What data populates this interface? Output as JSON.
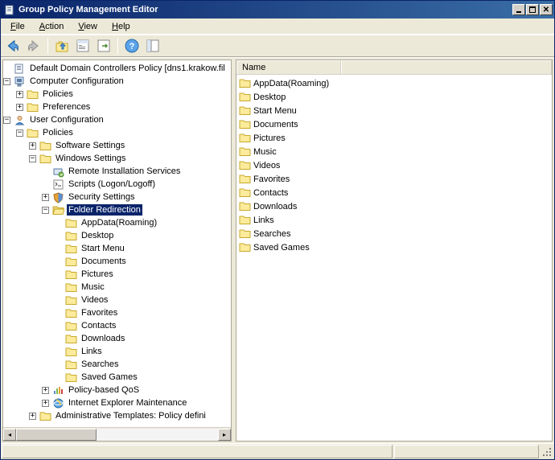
{
  "window": {
    "title": "Group Policy Management Editor"
  },
  "menu": {
    "file": "File",
    "action": "Action",
    "view": "View",
    "help": "Help"
  },
  "root": {
    "label": "Default Domain Controllers Policy [dns1.krakow.fil"
  },
  "computerCfg": {
    "label": "Computer Configuration",
    "policies": "Policies",
    "preferences": "Preferences"
  },
  "userCfg": {
    "label": "User Configuration",
    "policies": "Policies",
    "software": "Software Settings",
    "windows": "Windows Settings",
    "ris": "Remote Installation Services",
    "scripts": "Scripts (Logon/Logoff)",
    "security": "Security Settings",
    "folderRedir": "Folder Redirection",
    "qos": "Policy-based QoS",
    "ie": "Internet Explorer Maintenance",
    "adminTpl": "Administrative Templates: Policy defini"
  },
  "redir": {
    "items": [
      "AppData(Roaming)",
      "Desktop",
      "Start Menu",
      "Documents",
      "Pictures",
      "Music",
      "Videos",
      "Favorites",
      "Contacts",
      "Downloads",
      "Links",
      "Searches",
      "Saved Games"
    ]
  },
  "list": {
    "colName": "Name",
    "items": [
      "AppData(Roaming)",
      "Desktop",
      "Start Menu",
      "Documents",
      "Pictures",
      "Music",
      "Videos",
      "Favorites",
      "Contacts",
      "Downloads",
      "Links",
      "Searches",
      "Saved Games"
    ]
  }
}
